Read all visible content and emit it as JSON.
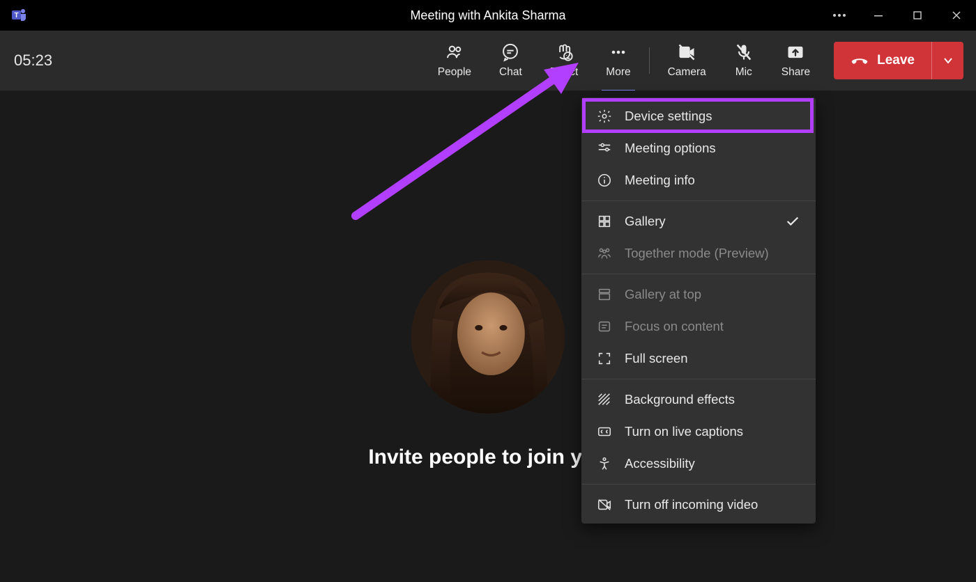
{
  "titlebar": {
    "title": "Meeting with Ankita Sharma"
  },
  "toolbar": {
    "timer": "05:23",
    "buttons": {
      "people": "People",
      "chat": "Chat",
      "react": "React",
      "more": "More",
      "camera": "Camera",
      "mic": "Mic",
      "share": "Share"
    },
    "leave": "Leave"
  },
  "main": {
    "invite_text": "Invite people to join you"
  },
  "menu": {
    "device_settings": "Device settings",
    "meeting_options": "Meeting options",
    "meeting_info": "Meeting info",
    "gallery": "Gallery",
    "together_mode": "Together mode (Preview)",
    "gallery_at_top": "Gallery at top",
    "focus_on_content": "Focus on content",
    "full_screen": "Full screen",
    "background_effects": "Background effects",
    "live_captions": "Turn on live captions",
    "accessibility": "Accessibility",
    "incoming_video": "Turn off incoming video"
  }
}
